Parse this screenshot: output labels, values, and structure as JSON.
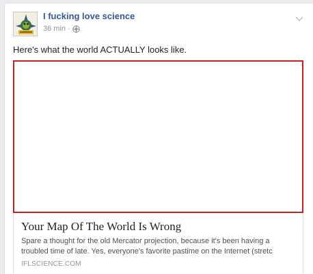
{
  "post": {
    "author": "I fucking love science",
    "time": "36 min",
    "separator": "·",
    "privacy_icon": "globe-icon",
    "menu_icon": "chevron-down-icon",
    "text": "Here's what the world ACTUALLY looks like."
  },
  "link": {
    "title": "Your Map Of The World Is Wrong",
    "description": "Spare a thought for the old Mercator projection, because it's been having a troubled time of late. Yes, everyone's favorite pastime on the Internet (stretc",
    "domain": "IFLSCIENCE.COM"
  },
  "colors": {
    "author_link": "#365899",
    "image_border": "#c81e1e",
    "meta_text": "#90949c"
  }
}
